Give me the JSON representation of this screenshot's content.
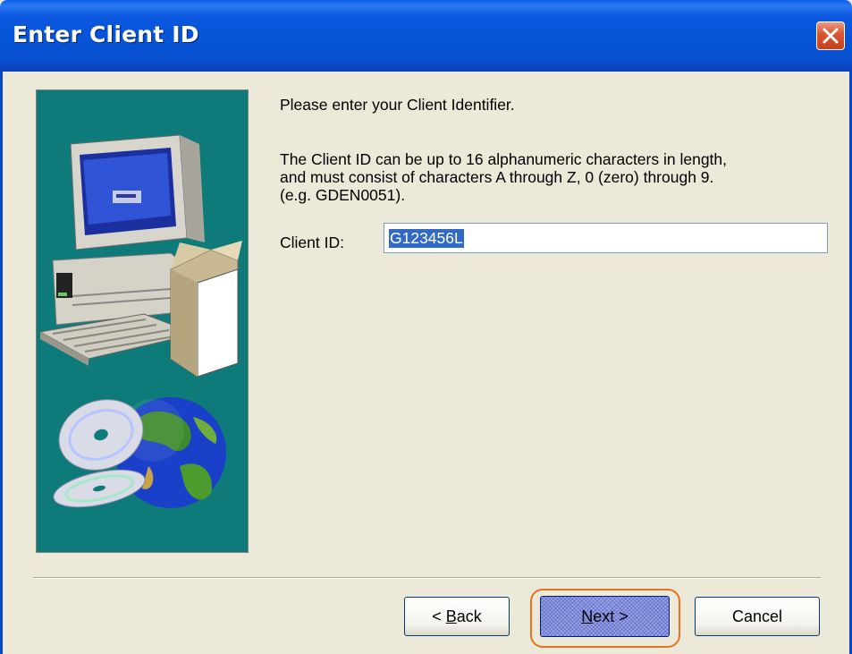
{
  "window": {
    "title": "Enter Client ID"
  },
  "message": {
    "prompt": "Please enter your Client Identifier.",
    "description_line1": "The Client ID can be up to 16 alphanumeric characters in length,",
    "description_line2": "and must consist of characters A through Z, 0 (zero) through 9.",
    "description_line3": "(e.g. GDEN0051)."
  },
  "client_id": {
    "label": "Client ID:",
    "value": "G123456L"
  },
  "buttons": {
    "back_prefix": "< ",
    "back_mnemonic": "B",
    "back_rest": "ack",
    "next_mnemonic": "N",
    "next_rest": "ext >",
    "cancel": "Cancel"
  },
  "colors": {
    "side_panel": "#0e7a7a",
    "highlight": "#e8701f",
    "selection": "#316ac5"
  },
  "icons": [
    "computer-icon",
    "cd-icon",
    "globe-icon",
    "close-icon"
  ]
}
